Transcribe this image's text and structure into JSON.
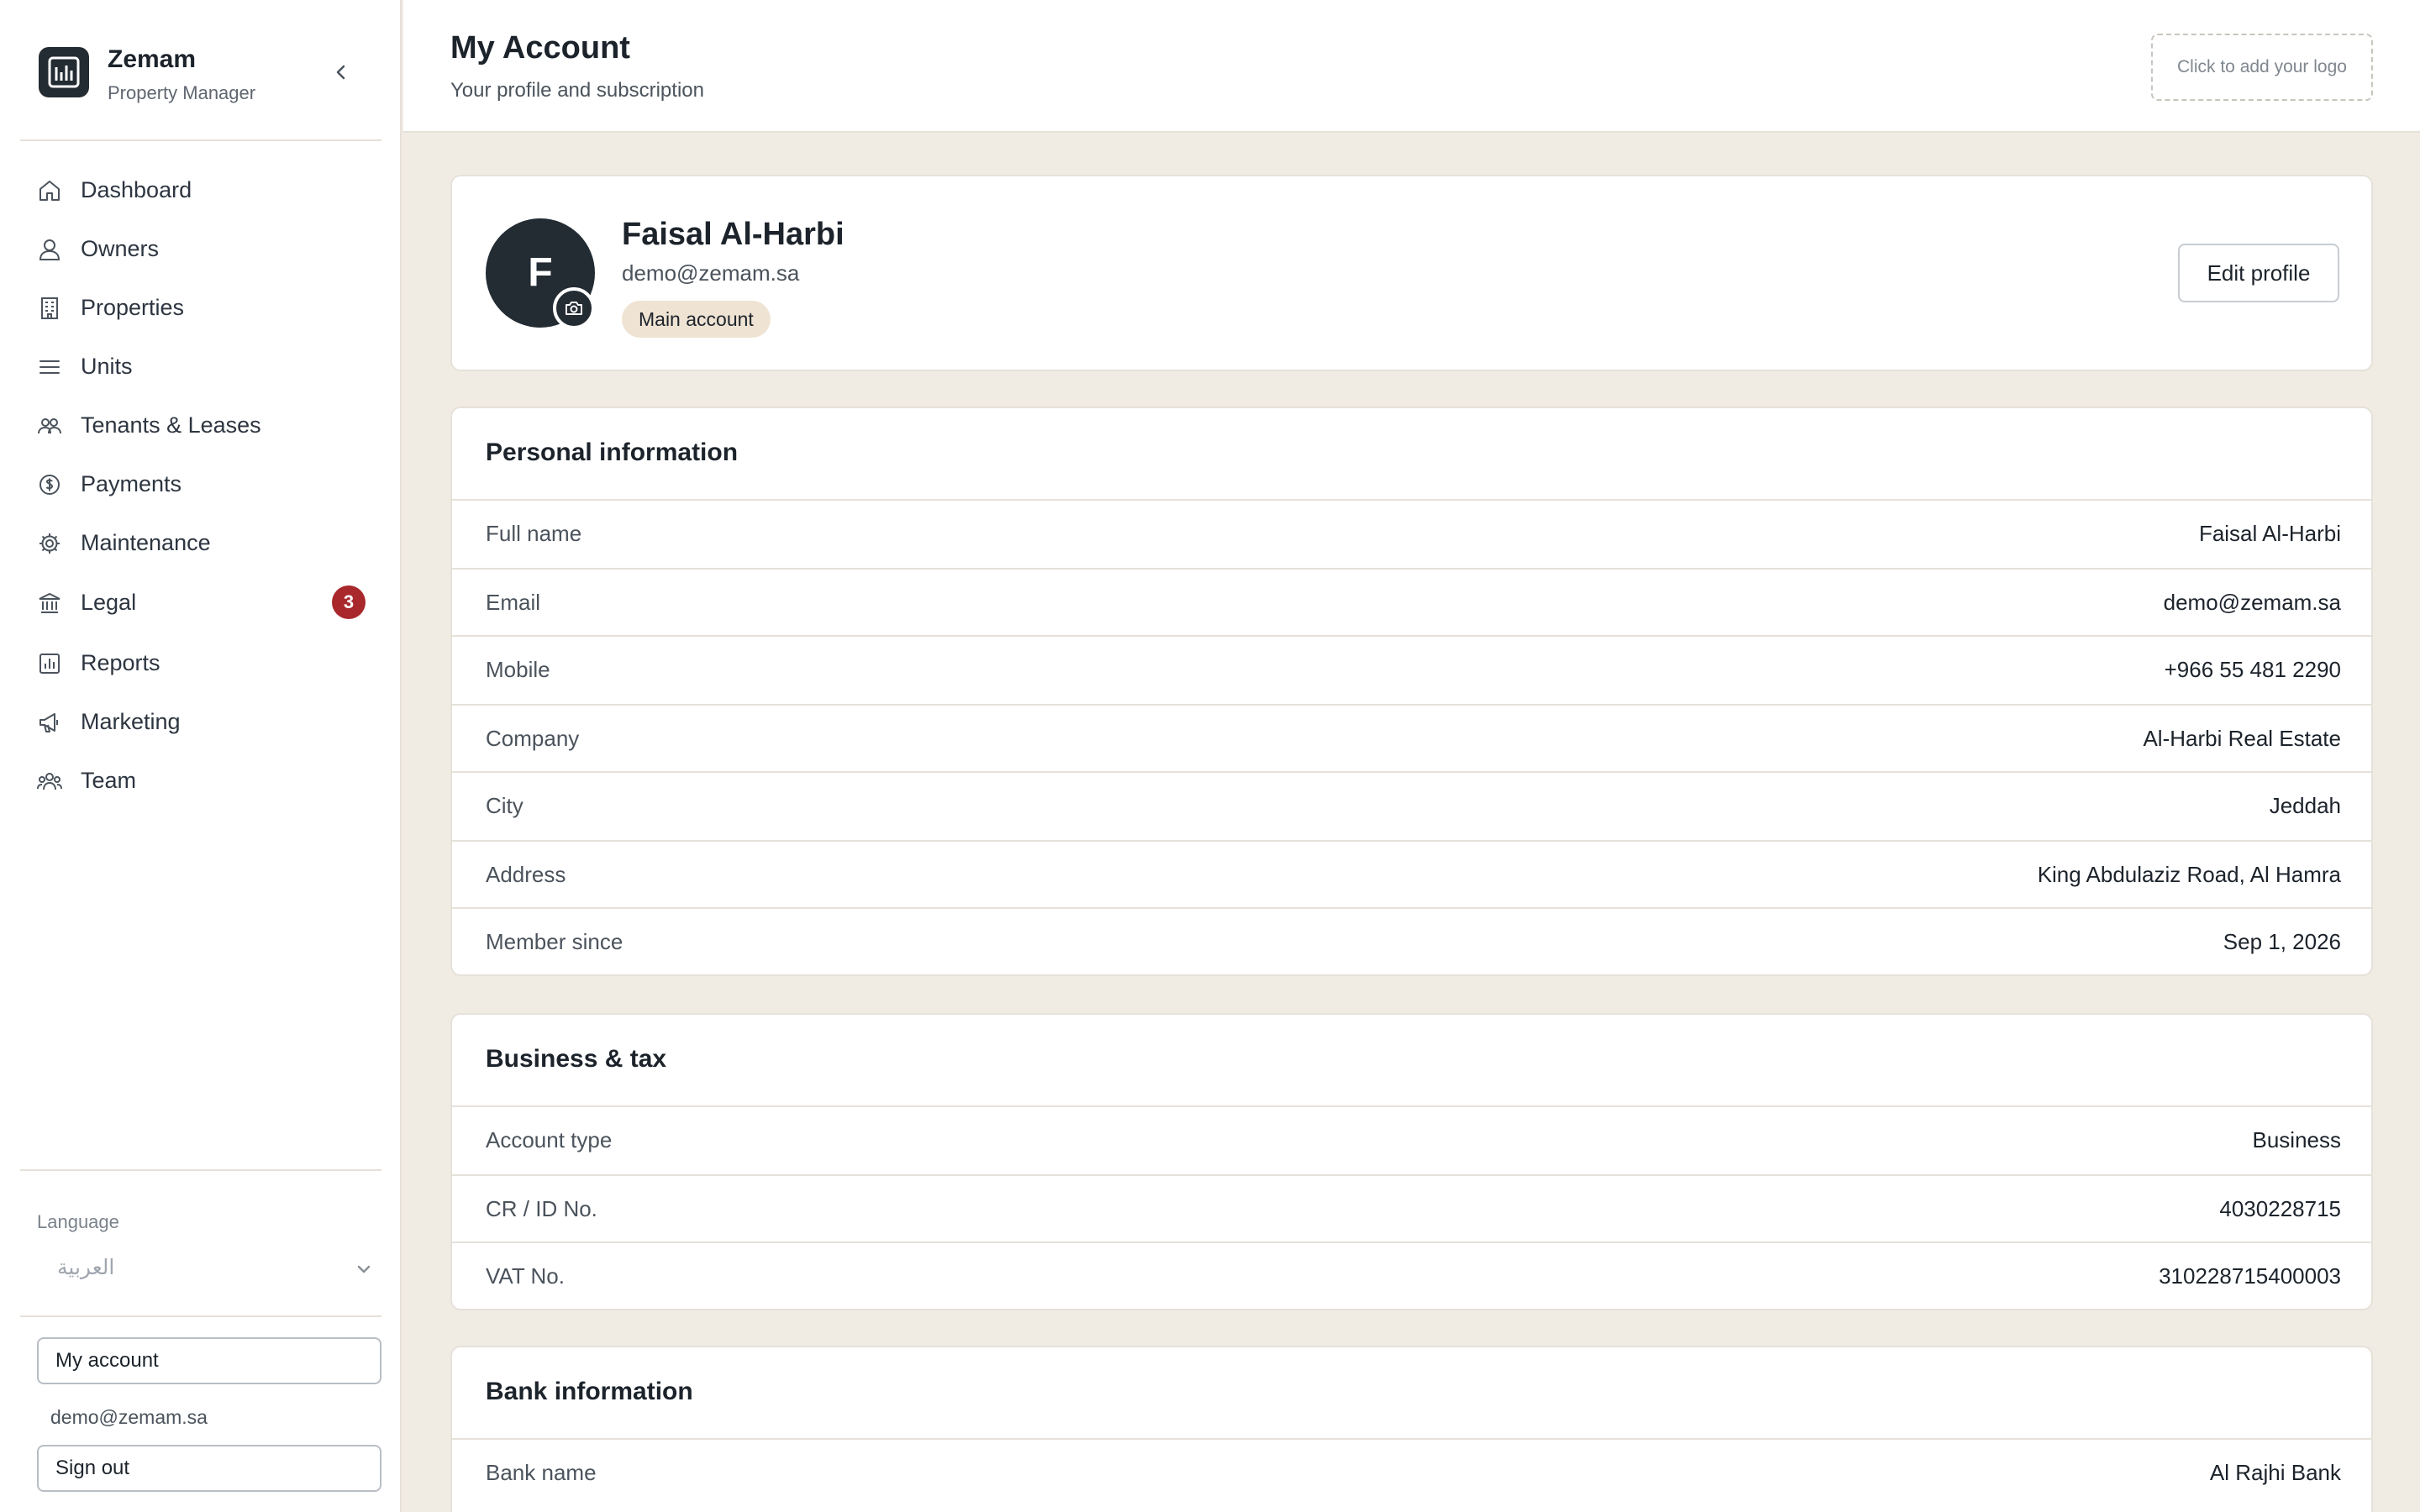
{
  "brand": {
    "name": "Zemam",
    "subtitle": "Property Manager"
  },
  "nav": [
    {
      "label": "Dashboard",
      "icon": "home-icon"
    },
    {
      "label": "Owners",
      "icon": "user-icon"
    },
    {
      "label": "Properties",
      "icon": "building-icon"
    },
    {
      "label": "Units",
      "icon": "list-icon"
    },
    {
      "label": "Tenants & Leases",
      "icon": "users-icon"
    },
    {
      "label": "Payments",
      "icon": "dollar-circle-icon"
    },
    {
      "label": "Maintenance",
      "icon": "gear-icon"
    },
    {
      "label": "Legal",
      "icon": "bank-icon",
      "badge": "3"
    },
    {
      "label": "Reports",
      "icon": "bar-chart-icon"
    },
    {
      "label": "Marketing",
      "icon": "megaphone-icon"
    },
    {
      "label": "Team",
      "icon": "team-icon"
    }
  ],
  "language": {
    "label": "Language",
    "value": "العربية"
  },
  "account": {
    "my_account_label": "My account",
    "email": "demo@zemam.sa",
    "sign_out_label": "Sign out"
  },
  "header": {
    "title": "My Account",
    "subtitle": "Your profile and subscription",
    "logo_placeholder": "Click to add your logo"
  },
  "profile": {
    "initial": "F",
    "name": "Faisal Al-Harbi",
    "email": "demo@zemam.sa",
    "badge": "Main account",
    "edit_label": "Edit profile"
  },
  "personal": {
    "title": "Personal information",
    "rows": [
      {
        "label": "Full name",
        "value": "Faisal Al-Harbi"
      },
      {
        "label": "Email",
        "value": "demo@zemam.sa"
      },
      {
        "label": "Mobile",
        "value": "+966 55 481 2290"
      },
      {
        "label": "Company",
        "value": "Al-Harbi Real Estate"
      },
      {
        "label": "City",
        "value": "Jeddah"
      },
      {
        "label": "Address",
        "value": "King Abdulaziz Road, Al Hamra"
      },
      {
        "label": "Member since",
        "value": "Sep 1, 2026"
      }
    ]
  },
  "business": {
    "title": "Business & tax",
    "rows": [
      {
        "label": "Account type",
        "value": "Business"
      },
      {
        "label": "CR / ID No.",
        "value": "4030228715"
      },
      {
        "label": "VAT No.",
        "value": "310228715400003"
      }
    ]
  },
  "bank": {
    "title": "Bank information",
    "rows": [
      {
        "label": "Bank name",
        "value": "Al Rajhi Bank"
      }
    ]
  },
  "colors": {
    "accent_dark": "#232b33",
    "badge_red": "#a8282c",
    "page_bg": "#f0ebe3",
    "chip_bg": "#efe3d3"
  }
}
